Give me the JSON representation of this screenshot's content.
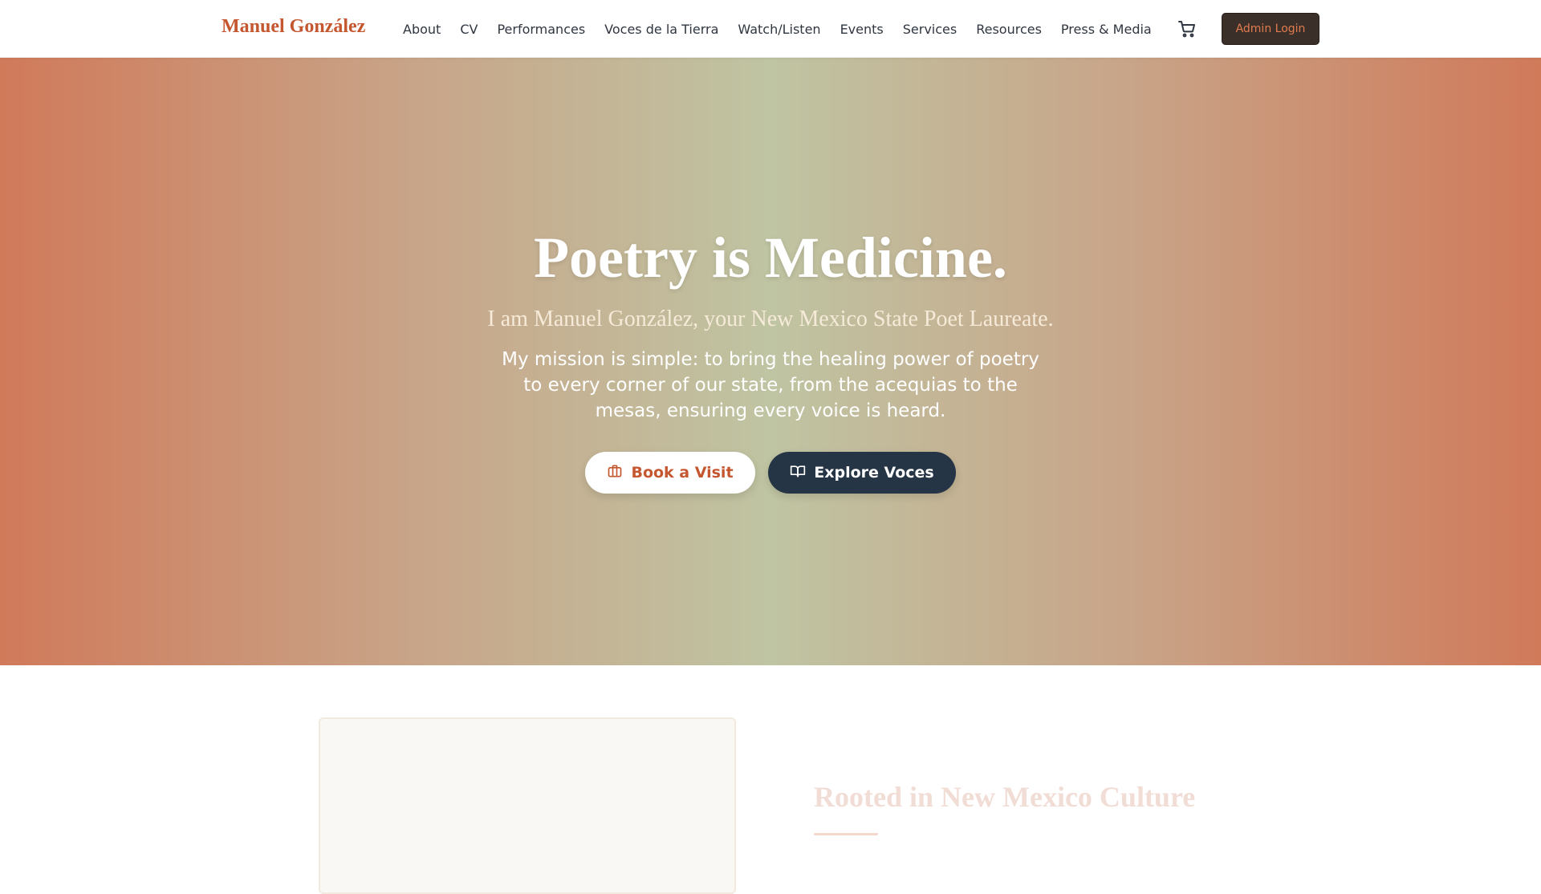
{
  "navbar": {
    "brand": "Manuel González",
    "links": [
      {
        "label": "About"
      },
      {
        "label": "CV"
      },
      {
        "label": "Performances"
      },
      {
        "label": "Voces de la Tierra"
      },
      {
        "label": "Watch/Listen"
      },
      {
        "label": "Events"
      },
      {
        "label": "Services"
      },
      {
        "label": "Resources"
      },
      {
        "label": "Press & Media"
      }
    ],
    "cart_icon": "shopping-cart-icon",
    "admin_label": "Admin Login"
  },
  "hero": {
    "title": "Poetry is Medicine.",
    "subtitle": "I am Manuel González, your New Mexico State Poet Laureate.",
    "mission": "My mission is simple: to bring the healing power of poetry to every corner of our state, from the acequias to the mesas, ensuring every voice is heard.",
    "primary_button": {
      "label": "Book a Visit",
      "icon": "briefcase-icon"
    },
    "secondary_button": {
      "label": "Explore Voces",
      "icon": "open-book-icon"
    }
  },
  "section": {
    "title": "Rooted in New Mexico Culture"
  },
  "colors": {
    "brand": "#c4572f",
    "dark_button": "#263545",
    "admin_bg": "#3b2f29",
    "hero_edge": "#d07a5a",
    "hero_center": "#bfc4a2"
  }
}
